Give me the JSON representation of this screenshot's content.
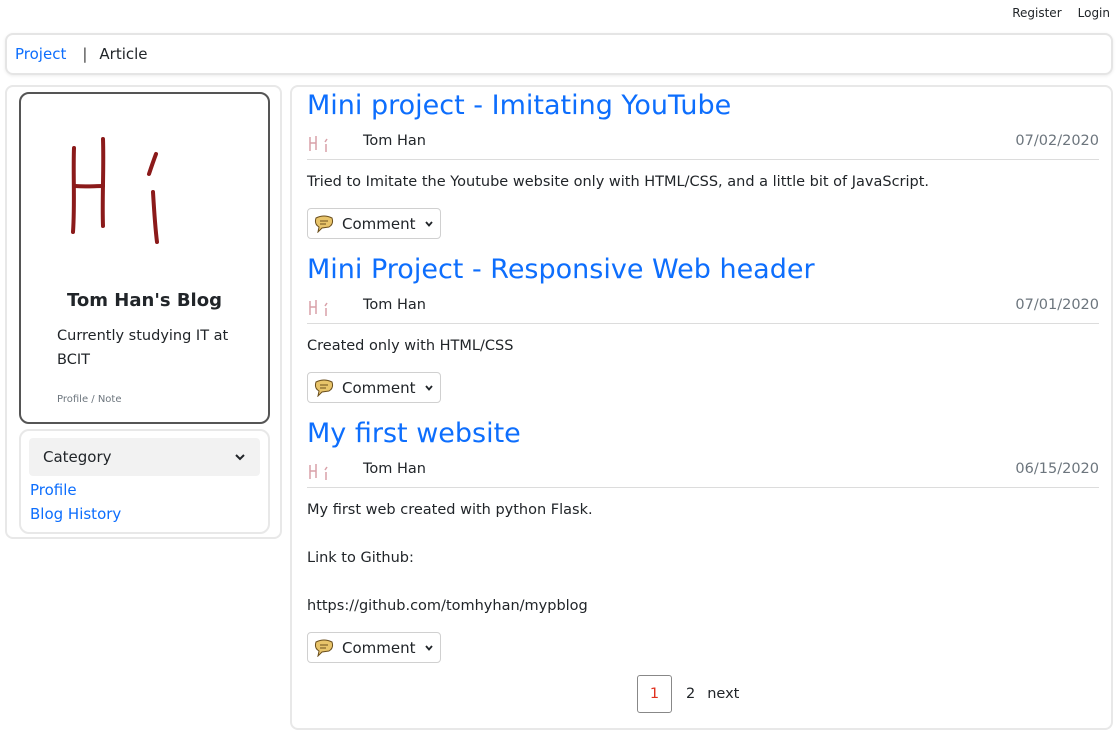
{
  "topbar": {
    "register": "Register",
    "login": "Login"
  },
  "nav": {
    "project": "Project",
    "separator": "|",
    "article": "Article"
  },
  "sidebar": {
    "blog_title": "Tom Han's Blog",
    "description": "Currently studying IT at BCIT",
    "profile_note": "Profile / Note",
    "category_label": "Category",
    "links": [
      "Profile",
      "Blog History"
    ]
  },
  "posts": [
    {
      "title": "Mini project - Imitating YouTube",
      "author": "Tom Han",
      "date": "07/02/2020",
      "body": [
        "Tried to Imitate the Youtube website only with HTML/CSS, and a little bit of JavaScript."
      ],
      "comment": "Comment"
    },
    {
      "title": "Mini Project - Responsive Web header",
      "author": "Tom Han",
      "date": "07/01/2020",
      "body": [
        "Created only with HTML/CSS"
      ],
      "comment": "Comment"
    },
    {
      "title": "My first website",
      "author": "Tom Han",
      "date": "06/15/2020",
      "body": [
        "My first web created with python Flask.",
        "",
        "Link to Github:",
        "",
        "https://github.com/tomhyhan/mypblog"
      ],
      "comment": "Comment"
    }
  ],
  "pagination": {
    "page1": "1",
    "page2": "2",
    "next": "next"
  },
  "colors": {
    "link": "#0d6efd",
    "logo_stroke": "#8b1a1a",
    "active_page": "#e0301e"
  }
}
